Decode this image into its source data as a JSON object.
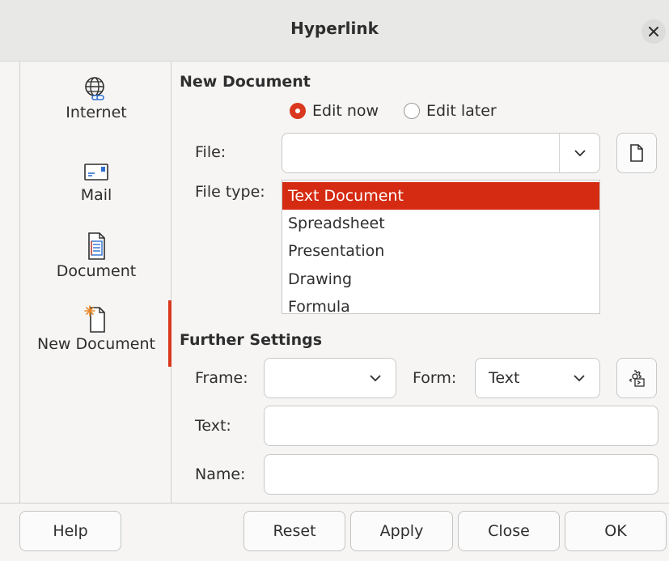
{
  "window": {
    "title": "Hyperlink"
  },
  "sidebar": {
    "items": [
      {
        "label": "Internet",
        "icon": "globe-link-icon"
      },
      {
        "label": "Mail",
        "icon": "envelope-icon"
      },
      {
        "label": "Document",
        "icon": "document-icon"
      },
      {
        "label": "New Document",
        "icon": "new-document-icon",
        "active": true
      }
    ]
  },
  "new_document": {
    "heading": "New Document",
    "edit_now_label": "Edit now",
    "edit_later_label": "Edit later",
    "edit_mode_selected": "Edit now",
    "file_label": "File:",
    "file_value": "",
    "file_type_label": "File type:",
    "file_types": [
      "Text Document",
      "Spreadsheet",
      "Presentation",
      "Drawing",
      "Formula"
    ],
    "file_type_selected": "Text Document"
  },
  "further_settings": {
    "heading": "Further Settings",
    "frame_label": "Frame:",
    "frame_value": "",
    "form_label": "Form:",
    "form_value": "Text",
    "text_label": "Text:",
    "text_value": "",
    "name_label": "Name:",
    "name_value": ""
  },
  "buttons": {
    "help": "Help",
    "reset": "Reset",
    "apply": "Apply",
    "close": "Close",
    "ok": "OK"
  },
  "colors": {
    "accent": "#d52b12",
    "radio_on": "#d9381e"
  }
}
